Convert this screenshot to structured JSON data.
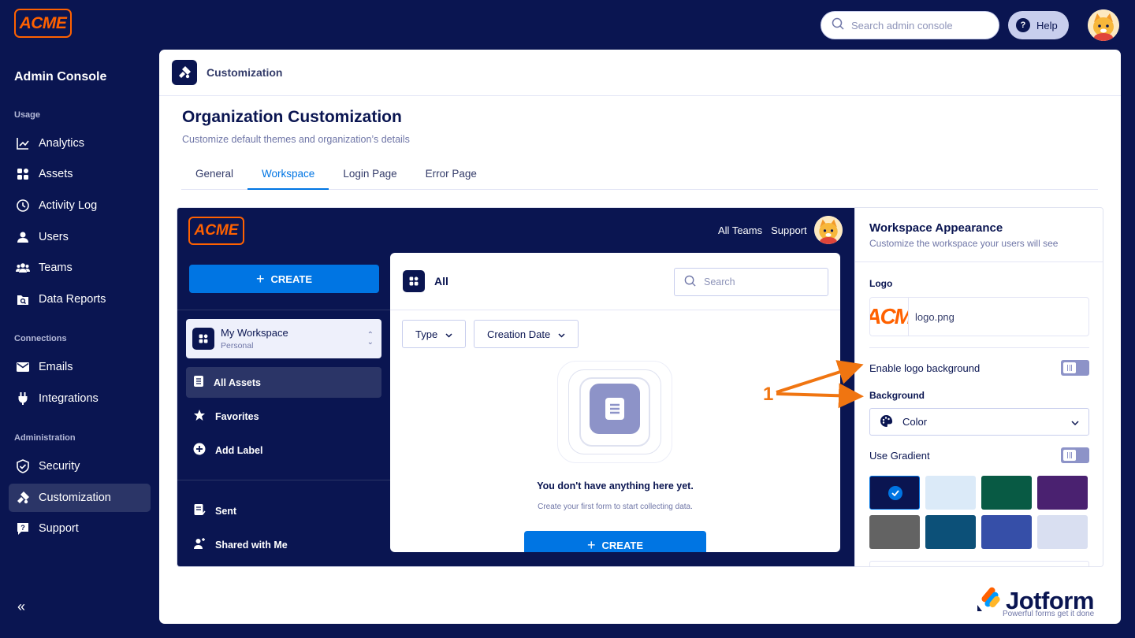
{
  "brand": {
    "logo_text": "ACME"
  },
  "header": {
    "search_placeholder": "Search admin console",
    "help_label": "Help"
  },
  "sidebar": {
    "title": "Admin Console",
    "sections": {
      "usage": "Usage",
      "connections": "Connections",
      "administration": "Administration"
    },
    "items": [
      {
        "label": "Analytics",
        "icon": "chart-line-icon"
      },
      {
        "label": "Assets",
        "icon": "grid-icon"
      },
      {
        "label": "Activity Log",
        "icon": "history-icon"
      },
      {
        "label": "Users",
        "icon": "user-icon"
      },
      {
        "label": "Teams",
        "icon": "team-icon"
      },
      {
        "label": "Data Reports",
        "icon": "report-icon"
      },
      {
        "label": "Emails",
        "icon": "mail-icon"
      },
      {
        "label": "Integrations",
        "icon": "plug-icon"
      },
      {
        "label": "Security",
        "icon": "shield-icon"
      },
      {
        "label": "Customization",
        "icon": "paint-roller-icon"
      },
      {
        "label": "Support",
        "icon": "question-icon"
      }
    ],
    "active": "Customization"
  },
  "main": {
    "header_label": "Customization",
    "title": "Organization Customization",
    "subtitle": "Customize default themes and organization’s details",
    "tabs": [
      {
        "label": "General"
      },
      {
        "label": "Workspace"
      },
      {
        "label": "Login Page"
      },
      {
        "label": "Error Page"
      }
    ],
    "active_tab": "Workspace"
  },
  "preview": {
    "logo_text": "ACME",
    "top_links": [
      "All Teams",
      "Support"
    ],
    "create_label": "CREATE",
    "workspace": {
      "name": "My Workspace",
      "type": "Personal"
    },
    "nav": [
      {
        "label": "All Assets"
      },
      {
        "label": "Favorites"
      },
      {
        "label": "Add Label"
      },
      {
        "label": "Sent"
      },
      {
        "label": "Shared with Me"
      }
    ],
    "panel": {
      "title": "All",
      "search_placeholder": "Search",
      "filters": [
        "Type",
        "Creation Date"
      ],
      "empty_title": "You don't have anything here yet.",
      "empty_sub": "Create your first form to start collecting data.",
      "create_label": "CREATE"
    }
  },
  "appearance": {
    "title": "Workspace Appearance",
    "subtitle": "Customize the workspace your users will see",
    "logo_label": "Logo",
    "logo_thumb_text": "ACM",
    "logo_file": "logo.png",
    "enable_logo_bg_label": "Enable logo background",
    "background_label": "Background",
    "background_value": "Color",
    "use_gradient_label": "Use Gradient",
    "swatches": [
      "#0a1551",
      "#dbeaf8",
      "#085a44",
      "#4a2170",
      "#636363",
      "#0c5078",
      "#364fa8",
      "#d9dff1"
    ],
    "selected_swatch": 0
  },
  "annotation": {
    "number": "1",
    "color": "#f07511"
  },
  "watermark": {
    "word": "Jotform",
    "tagline": "Powerful forms get it done"
  }
}
